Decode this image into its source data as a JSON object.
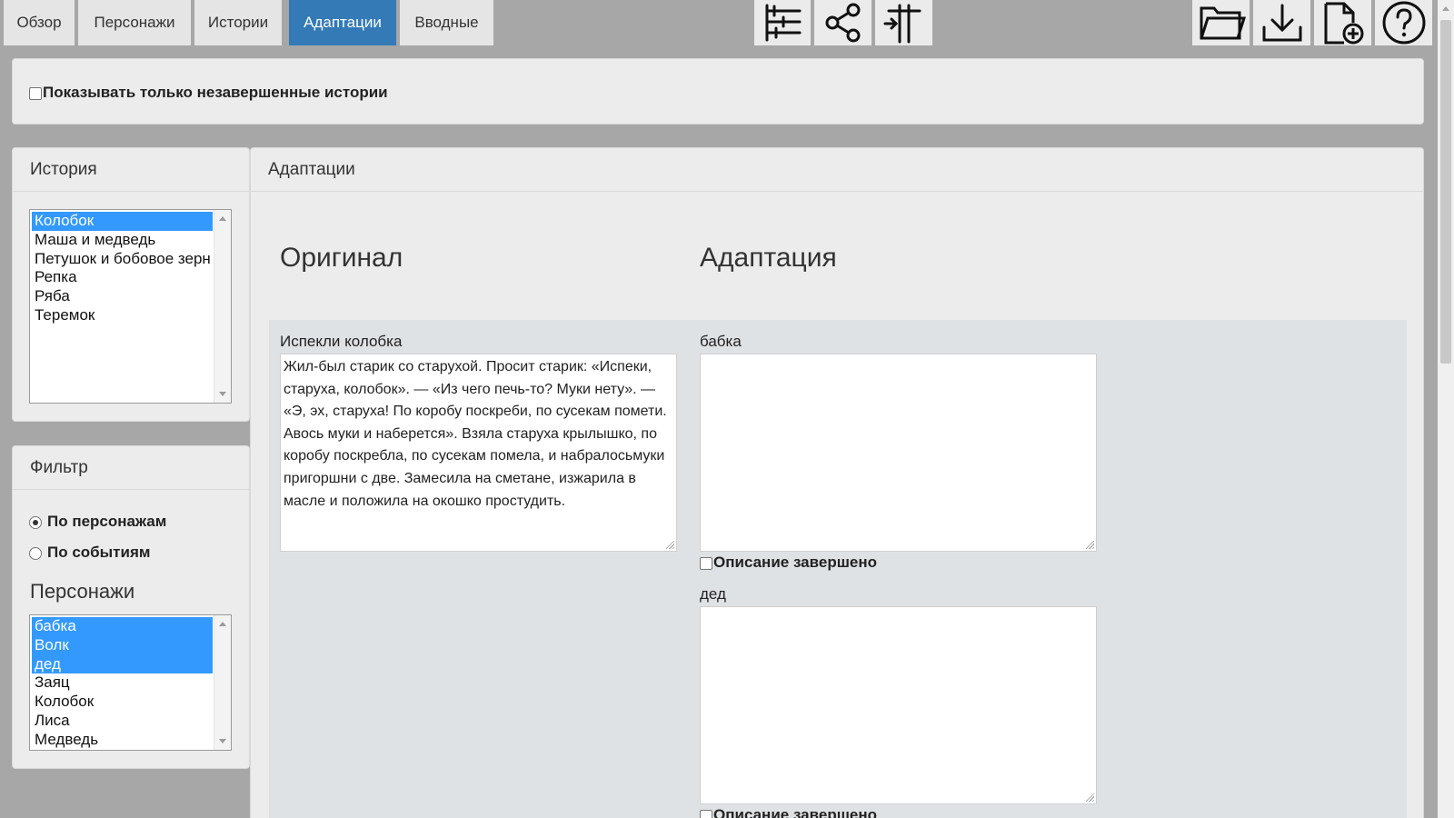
{
  "nav": {
    "tabs": [
      {
        "label": "Обзор",
        "active": false
      },
      {
        "label": "Персонажи",
        "active": false
      },
      {
        "label": "Истории",
        "active": false
      },
      {
        "label": "Адаптации",
        "active": true
      },
      {
        "label": "Вводные",
        "active": false
      }
    ],
    "center_icons": [
      "timeline-icon",
      "share-icon",
      "split-icon"
    ],
    "right_icons": [
      "folder-icon",
      "download-icon",
      "new-file-icon",
      "help-icon"
    ]
  },
  "topbar": {
    "checkbox_label": "Показывать только незавершенные истории",
    "checked": false
  },
  "story_panel": {
    "title": "История",
    "stories": [
      "Колобок",
      "Маша и медведь",
      "Петушок и бобовое зерн",
      "Репка",
      "Ряба",
      "Теремок"
    ],
    "selected": "Колобок"
  },
  "filter_panel": {
    "title": "Фильтр",
    "options": [
      {
        "label": "По персонажам",
        "checked": true
      },
      {
        "label": "По событиям",
        "checked": false
      }
    ],
    "characters_title": "Персонажи",
    "characters": [
      "бабка",
      "Волк",
      "дед",
      "Заяц",
      "Колобок",
      "Лиса",
      "Медведь"
    ],
    "selected_characters": [
      "бабка",
      "Волк",
      "дед"
    ]
  },
  "main": {
    "title": "Адаптации",
    "original_heading": "Оригинал",
    "adaptation_heading": "Адаптация",
    "event_title": "Испекли колобка",
    "original_text": "Жил-был старик со старухой. Просит старик: «Испеки, старуха, колобок». — «Из чего печь-то? Муки нету». — «Э, эх, старуха! По коробу поскреби, по сусекам помети. Авось муки и наберется». Взяла старуха крылышко, по коробу поскребла, по сусекам помела, и набралосьмуки пригоршни с две. Замесила на сметане, изжарила в масле и положила на окошко простудить.",
    "adaptations": [
      {
        "character": "бабка",
        "text": "",
        "done_label": "Описание завершено",
        "done": false
      },
      {
        "character": "дед",
        "text": "",
        "done_label": "Описание завершено",
        "done": false
      }
    ]
  }
}
